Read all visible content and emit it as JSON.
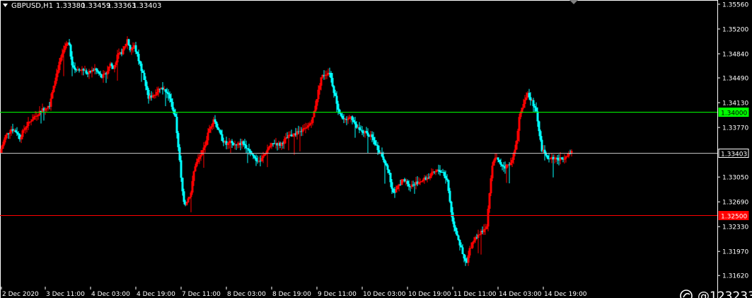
{
  "header": {
    "symbol": "GBPUSD,H1",
    "open": "1.33380",
    "high": "1.33459",
    "low": "1.33363",
    "close": "1.33403"
  },
  "watermark": "@123233",
  "colors": {
    "background": "#000000",
    "bull": "#ff0000",
    "bear": "#00ffff",
    "grid_text": "#ffffff",
    "resistance": "#00ff00",
    "support": "#ff0000",
    "current": "#c0c0c0"
  },
  "chart_data": {
    "type": "candlestick",
    "timeframe": "H1",
    "y_ticks": [
      "1.35560",
      "1.35200",
      "1.34840",
      "1.34490",
      "1.34130",
      "1.33770",
      "1.33050",
      "1.32690",
      "1.32330",
      "1.31970",
      "1.31620",
      "1.31260"
    ],
    "x_ticks": [
      "2 Dec 2020",
      "3 Dec 11:00",
      "4 Dec 03:00",
      "4 Dec 19:00",
      "7 Dec 11:00",
      "8 Dec 03:00",
      "8 Dec 19:00",
      "9 Dec 11:00",
      "10 Dec 03:00",
      "10 Dec 19:00",
      "11 Dec 11:00",
      "14 Dec 03:00",
      "14 Dec 19:00"
    ],
    "ylim": [
      1.31242,
      1.3558
    ],
    "levels": [
      {
        "name": "resistance",
        "price": 1.34,
        "label": "1.34000"
      },
      {
        "name": "current",
        "price": 1.33403,
        "label": "1.33403"
      },
      {
        "name": "support",
        "price": 1.325,
        "label": "1.32500"
      }
    ],
    "path": [
      [
        0,
        1.334
      ],
      [
        8,
        1.3365
      ],
      [
        16,
        1.3375
      ],
      [
        24,
        1.337
      ],
      [
        28,
        1.3362
      ],
      [
        36,
        1.3378
      ],
      [
        46,
        1.339
      ],
      [
        56,
        1.34
      ],
      [
        70,
        1.341
      ],
      [
        76,
        1.344
      ],
      [
        84,
        1.347
      ],
      [
        92,
        1.3495
      ],
      [
        97,
        1.35
      ],
      [
        102,
        1.347
      ],
      [
        108,
        1.3458
      ],
      [
        116,
        1.3462
      ],
      [
        124,
        1.3455
      ],
      [
        134,
        1.3462
      ],
      [
        144,
        1.345
      ],
      [
        150,
        1.3455
      ],
      [
        156,
        1.347
      ],
      [
        160,
        1.3462
      ],
      [
        166,
        1.348
      ],
      [
        174,
        1.3488
      ],
      [
        180,
        1.3505
      ],
      [
        184,
        1.349
      ],
      [
        190,
        1.3495
      ],
      [
        196,
        1.3475
      ],
      [
        202,
        1.3455
      ],
      [
        210,
        1.342
      ],
      [
        218,
        1.3425
      ],
      [
        226,
        1.3435
      ],
      [
        232,
        1.3432
      ],
      [
        240,
        1.342
      ],
      [
        248,
        1.339
      ],
      [
        253,
        1.334
      ],
      [
        257,
        1.329
      ],
      [
        261,
        1.3265
      ],
      [
        265,
        1.3272
      ],
      [
        270,
        1.3282
      ],
      [
        275,
        1.332
      ],
      [
        280,
        1.333
      ],
      [
        288,
        1.3345
      ],
      [
        296,
        1.3375
      ],
      [
        302,
        1.339
      ],
      [
        308,
        1.3375
      ],
      [
        314,
        1.336
      ],
      [
        320,
        1.3352
      ],
      [
        326,
        1.3355
      ],
      [
        334,
        1.335
      ],
      [
        342,
        1.3355
      ],
      [
        350,
        1.3348
      ],
      [
        356,
        1.3338
      ],
      [
        362,
        1.333
      ],
      [
        368,
        1.3328
      ],
      [
        374,
        1.3338
      ],
      [
        380,
        1.3348
      ],
      [
        388,
        1.3355
      ],
      [
        396,
        1.3352
      ],
      [
        404,
        1.336
      ],
      [
        410,
        1.3365
      ],
      [
        418,
        1.3368
      ],
      [
        426,
        1.3372
      ],
      [
        434,
        1.3376
      ],
      [
        442,
        1.339
      ],
      [
        448,
        1.342
      ],
      [
        454,
        1.345
      ],
      [
        460,
        1.3455
      ],
      [
        466,
        1.3458
      ],
      [
        472,
        1.343
      ],
      [
        478,
        1.3405
      ],
      [
        484,
        1.339
      ],
      [
        490,
        1.3385
      ],
      [
        496,
        1.3395
      ],
      [
        502,
        1.338
      ],
      [
        508,
        1.3372
      ],
      [
        514,
        1.337
      ],
      [
        520,
        1.3368
      ],
      [
        526,
        1.3362
      ],
      [
        532,
        1.335
      ],
      [
        538,
        1.334
      ],
      [
        544,
        1.3328
      ],
      [
        550,
        1.331
      ],
      [
        554,
        1.329
      ],
      [
        558,
        1.328
      ],
      [
        562,
        1.329
      ],
      [
        568,
        1.33
      ],
      [
        574,
        1.3298
      ],
      [
        580,
        1.3292
      ],
      [
        586,
        1.3296
      ],
      [
        592,
        1.3298
      ],
      [
        600,
        1.3302
      ],
      [
        606,
        1.3305
      ],
      [
        612,
        1.331
      ],
      [
        620,
        1.3315
      ],
      [
        626,
        1.3312
      ],
      [
        632,
        1.33
      ],
      [
        636,
        1.327
      ],
      [
        640,
        1.324
      ],
      [
        646,
        1.3222
      ],
      [
        652,
        1.32
      ],
      [
        656,
        1.3185
      ],
      [
        660,
        1.318
      ],
      [
        664,
        1.32
      ],
      [
        670,
        1.3215
      ],
      [
        676,
        1.3222
      ],
      [
        682,
        1.3225
      ],
      [
        688,
        1.3235
      ],
      [
        692,
        1.3282
      ],
      [
        696,
        1.332
      ],
      [
        700,
        1.3335
      ],
      [
        706,
        1.3325
      ],
      [
        714,
        1.332
      ],
      [
        722,
        1.3325
      ],
      [
        728,
        1.3345
      ],
      [
        734,
        1.339
      ],
      [
        740,
        1.341
      ],
      [
        746,
        1.3425
      ],
      [
        752,
        1.3415
      ],
      [
        758,
        1.34
      ],
      [
        762,
        1.337
      ],
      [
        766,
        1.3345
      ],
      [
        772,
        1.3335
      ],
      [
        778,
        1.3332
      ],
      [
        784,
        1.3333
      ],
      [
        790,
        1.333
      ],
      [
        796,
        1.3333
      ],
      [
        802,
        1.3338
      ],
      [
        808,
        1.334
      ]
    ]
  }
}
